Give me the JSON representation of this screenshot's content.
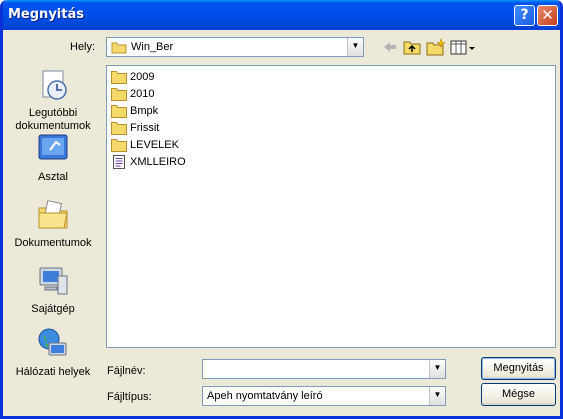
{
  "window": {
    "title": "Megnyitás"
  },
  "titlebar": {
    "help_symbol": "?",
    "close_symbol": "✕"
  },
  "location": {
    "label": "Hely:",
    "current_folder": "Win_Ber"
  },
  "sidebar": {
    "items": [
      {
        "label": "Legutóbbi dokumentumok",
        "icon": "recent-documents-icon"
      },
      {
        "label": "Asztal",
        "icon": "desktop-icon"
      },
      {
        "label": "Dokumentumok",
        "icon": "my-documents-icon"
      },
      {
        "label": "Sajátgép",
        "icon": "my-computer-icon"
      },
      {
        "label": "Hálózati helyek",
        "icon": "network-places-icon"
      }
    ]
  },
  "files": [
    {
      "name": "2009",
      "type": "folder"
    },
    {
      "name": "2010",
      "type": "folder"
    },
    {
      "name": "Bmpk",
      "type": "folder"
    },
    {
      "name": "Frissit",
      "type": "folder"
    },
    {
      "name": "LEVELEK",
      "type": "folder"
    },
    {
      "name": "XMLLEIRO",
      "type": "file"
    }
  ],
  "filename": {
    "label": "Fájlnév:",
    "value": ""
  },
  "filetype": {
    "label": "Fájltípus:",
    "value": "Apeh nyomtatvány leíró"
  },
  "buttons": {
    "open": "Megnyitás",
    "cancel": "Mégse"
  },
  "colors": {
    "titlebar": "#0054e3",
    "dialog_bg": "#ece9d8",
    "folder": "#f5d96b"
  }
}
